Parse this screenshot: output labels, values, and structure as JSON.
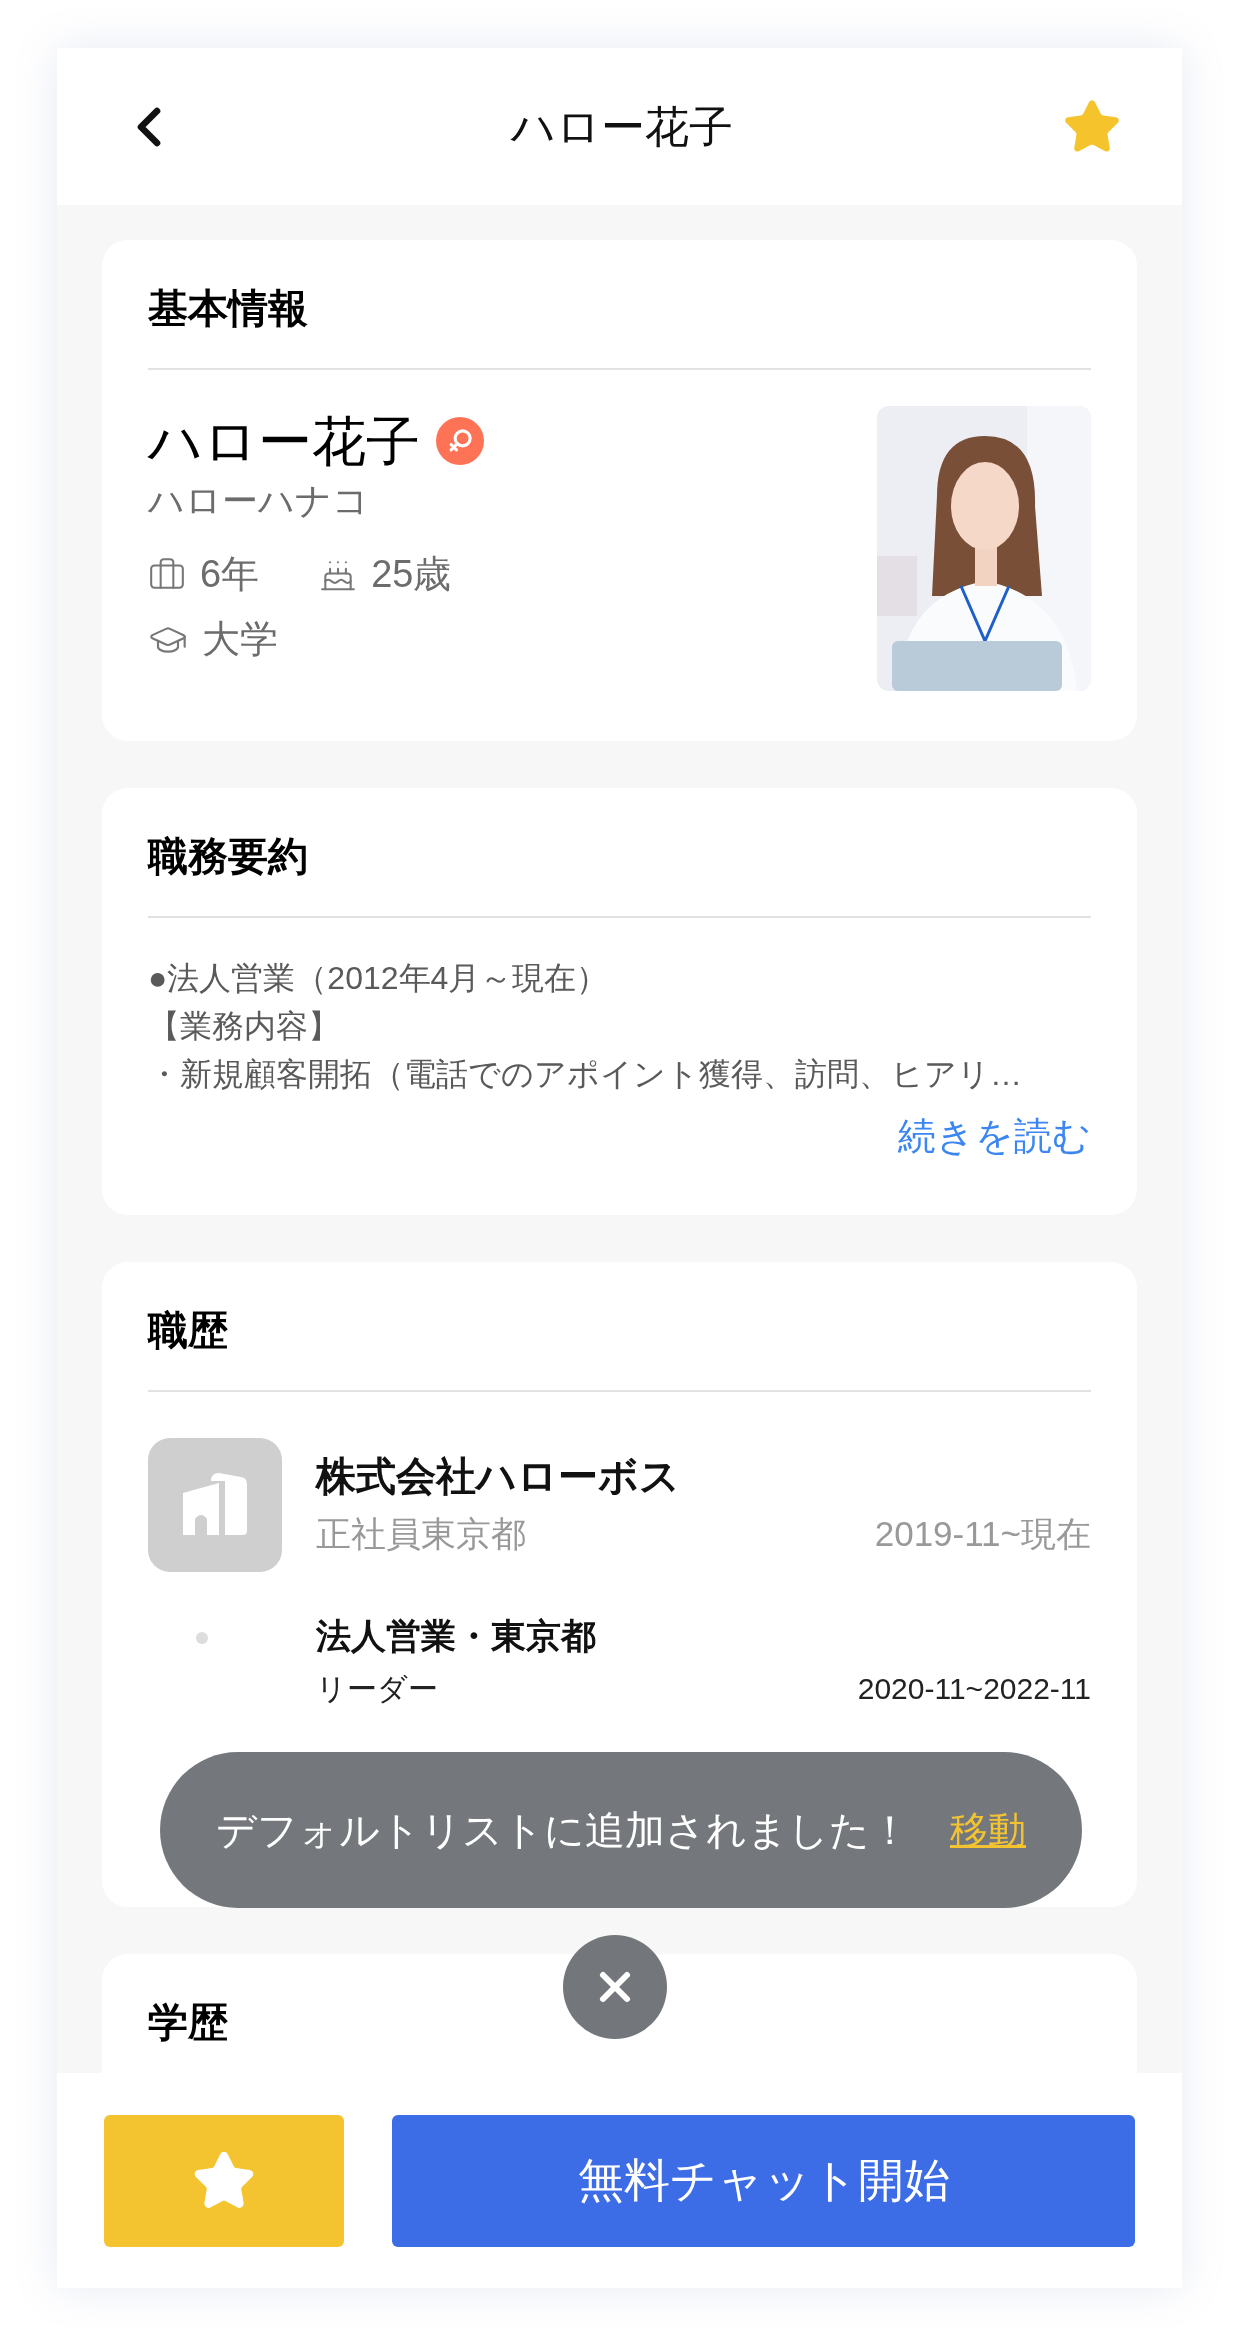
{
  "header": {
    "title": "ハロー花子",
    "favorite": true
  },
  "basic_info": {
    "heading": "基本情報",
    "name": "ハロー花子",
    "kana": "ハローハナコ",
    "experience": "6年",
    "age": "25歳",
    "education": "大学"
  },
  "summary": {
    "heading": "職務要約",
    "lines": [
      "●法人営業（2012年4月～現在）",
      "【業務内容】",
      "・新規顧客開拓（電話でのアポイント獲得、訪問、ヒアリ…"
    ],
    "read_more": "続きを読む"
  },
  "career": {
    "heading": "職歴",
    "companies": [
      {
        "name": "株式会社ハローボス",
        "employment": "正社員東京都",
        "period": "2019-11~現在",
        "positions": [
          {
            "title": "法人営業・東京都",
            "role": "リーダー",
            "period": "2020-11~2022-11"
          }
        ]
      }
    ]
  },
  "education": {
    "heading": "学歴"
  },
  "toast": {
    "message": "デフォルトリストに追加されました！",
    "action": "移動"
  },
  "bottom_bar": {
    "chat_button": "無料チャット開始"
  }
}
